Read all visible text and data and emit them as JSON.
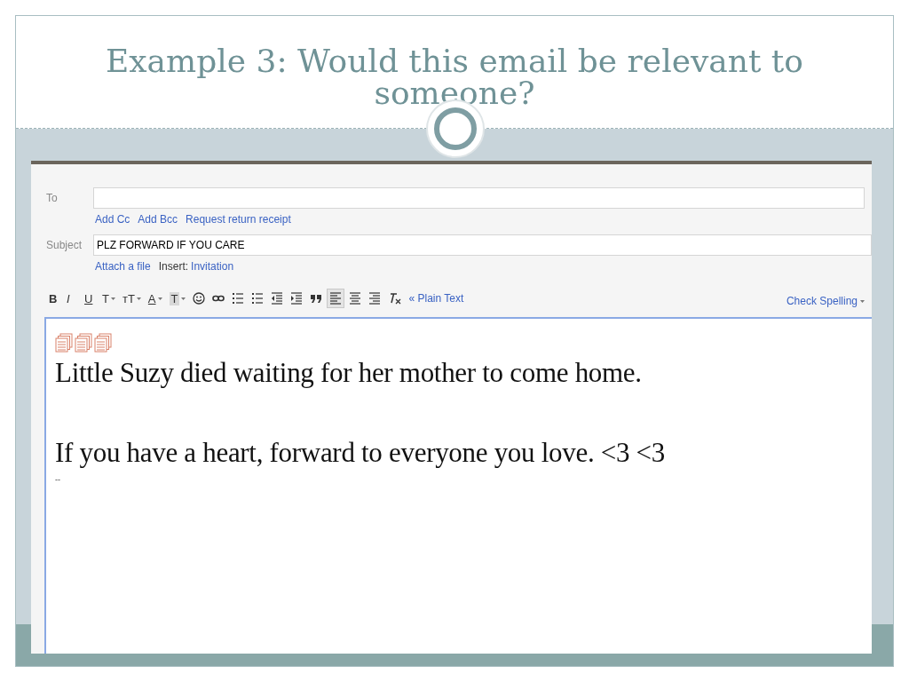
{
  "slide": {
    "title": "Example 3: Would this email be relevant to someone?"
  },
  "compose": {
    "to_label": "To",
    "cc_links": [
      "Add Cc",
      "Add Bcc",
      "Request return receipt"
    ],
    "subject_label": "Subject",
    "subject_value": "PLZ FORWARD IF YOU CARE",
    "attach_link": "Attach a file",
    "insert_label": "Insert:",
    "insert_link": "Invitation",
    "toolbar": [
      {
        "kind": "bold",
        "label": "B",
        "dropdown": false,
        "selected": false
      },
      {
        "kind": "italic",
        "label": "I",
        "dropdown": false,
        "selected": false
      },
      {
        "kind": "underline",
        "label": "U",
        "dropdown": false,
        "selected": false
      },
      {
        "kind": "font",
        "label": "T",
        "dropdown": true,
        "selected": false
      },
      {
        "kind": "size",
        "label": "тT",
        "dropdown": true,
        "selected": false
      },
      {
        "kind": "color",
        "label": "A",
        "dropdown": true,
        "selected": false
      },
      {
        "kind": "highlight",
        "label": "T",
        "dropdown": true,
        "selected": false
      },
      {
        "kind": "emoji",
        "dropdown": false,
        "selected": false
      },
      {
        "kind": "link",
        "dropdown": false,
        "selected": false
      },
      {
        "kind": "numbered-list",
        "dropdown": false,
        "selected": false
      },
      {
        "kind": "bullet-list",
        "dropdown": false,
        "selected": false
      },
      {
        "kind": "indent-less",
        "dropdown": false,
        "selected": false
      },
      {
        "kind": "indent-more",
        "dropdown": false,
        "selected": false
      },
      {
        "kind": "quote",
        "dropdown": false,
        "selected": false
      },
      {
        "kind": "align-left",
        "dropdown": false,
        "selected": true
      },
      {
        "kind": "align-center",
        "dropdown": false,
        "selected": false
      },
      {
        "kind": "align-right",
        "dropdown": false,
        "selected": false
      },
      {
        "kind": "clear-format",
        "dropdown": false,
        "selected": false
      }
    ],
    "plain_text_link": "« Plain Text",
    "check_spelling": "Check Spelling",
    "body": {
      "icons": [
        {
          "kind": "document-stack"
        },
        {
          "kind": "document-stack"
        },
        {
          "kind": "document-stack"
        }
      ],
      "lines": [
        "Little Suzy died waiting for her mother to come home.",
        "If you have a heart, forward to everyone you love. <3 <3"
      ],
      "signature": "--"
    }
  }
}
